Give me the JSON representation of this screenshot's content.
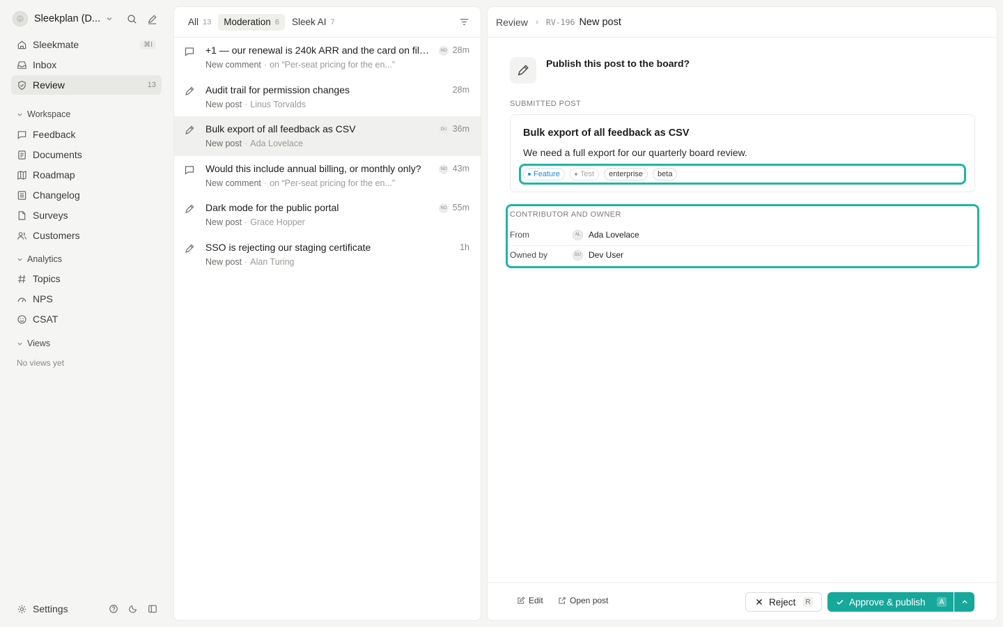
{
  "workspace": {
    "name": "Sleekplan (D...",
    "shortcut": "⌘I"
  },
  "sidebar": {
    "top_items": [
      {
        "label": "Sleekmate",
        "icon": "home-icon",
        "shortcut": "⌘I"
      },
      {
        "label": "Inbox",
        "icon": "inbox-icon"
      },
      {
        "label": "Review",
        "icon": "shield-icon",
        "badge": "13",
        "active": true
      }
    ],
    "workspace_section": {
      "title": "Workspace",
      "items": [
        {
          "label": "Feedback",
          "icon": "message-icon"
        },
        {
          "label": "Documents",
          "icon": "document-icon"
        },
        {
          "label": "Roadmap",
          "icon": "map-icon"
        },
        {
          "label": "Changelog",
          "icon": "list-icon"
        },
        {
          "label": "Surveys",
          "icon": "file-icon"
        },
        {
          "label": "Customers",
          "icon": "users-icon"
        }
      ]
    },
    "analytics_section": {
      "title": "Analytics",
      "items": [
        {
          "label": "Topics",
          "icon": "hash-icon"
        },
        {
          "label": "NPS",
          "icon": "gauge-icon"
        },
        {
          "label": "CSAT",
          "icon": "smile-icon"
        }
      ]
    },
    "views_section": {
      "title": "Views",
      "empty": "No views yet"
    },
    "settings_label": "Settings"
  },
  "list": {
    "tabs": [
      {
        "label": "All",
        "count": "13"
      },
      {
        "label": "Moderation",
        "count": "6",
        "active": true
      },
      {
        "label": "Sleek AI",
        "count": "7"
      }
    ],
    "items": [
      {
        "type": "comment",
        "title": "+1 — our renewal is 240k ARR and the card on file i...",
        "kind": "New comment",
        "meta": "on “Per-seat pricing for the en...”",
        "avatar": "NO",
        "time": "28m"
      },
      {
        "type": "post",
        "title": "Audit trail for permission changes",
        "kind": "New post",
        "meta": "Linus Torvalds",
        "avatar": "",
        "time": "28m"
      },
      {
        "type": "post",
        "title": "Bulk export of all feedback as CSV",
        "kind": "New post",
        "meta": "Ada Lovelace",
        "avatar": "DU",
        "time": "36m",
        "selected": true
      },
      {
        "type": "comment",
        "title": "Would this include annual billing, or monthly only?",
        "kind": "New comment",
        "meta": "on “Per-seat pricing for the en...”",
        "avatar": "NO",
        "time": "43m"
      },
      {
        "type": "post",
        "title": "Dark mode for the public portal",
        "kind": "New post",
        "meta": "Grace Hopper",
        "avatar": "NO",
        "time": "55m"
      },
      {
        "type": "post",
        "title": "SSO is rejecting our staging certificate",
        "kind": "New post",
        "meta": "Alan Turing",
        "avatar": "",
        "time": "1h"
      }
    ]
  },
  "detail": {
    "breadcrumb": {
      "section": "Review",
      "id": "RV-196",
      "title": "New post"
    },
    "question": "Publish this post to the board?",
    "submitted_label": "Submitted post",
    "post": {
      "title": "Bulk export of all feedback as CSV",
      "body": "We need a full export for our quarterly board review.",
      "tags": [
        {
          "label": "Feature",
          "style": "feature"
        },
        {
          "label": "Test",
          "style": "test"
        },
        {
          "label": "enterprise",
          "style": "plain"
        },
        {
          "label": "beta",
          "style": "plain"
        }
      ]
    },
    "owner_section": {
      "label": "Contributor and owner",
      "from_label": "From",
      "from_initials": "AL",
      "from_name": "Ada Lovelace",
      "owned_label": "Owned by",
      "owned_initials": "DU",
      "owned_name": "Dev User"
    },
    "footer": {
      "edit": "Edit",
      "open_post": "Open post",
      "reject": "Reject",
      "reject_key": "R",
      "approve": "Approve & publish",
      "approve_key": "A"
    }
  },
  "colors": {
    "accent": "#16a89a",
    "highlight": "#1fb5a6",
    "feature_tag": "#1a8fd6"
  }
}
